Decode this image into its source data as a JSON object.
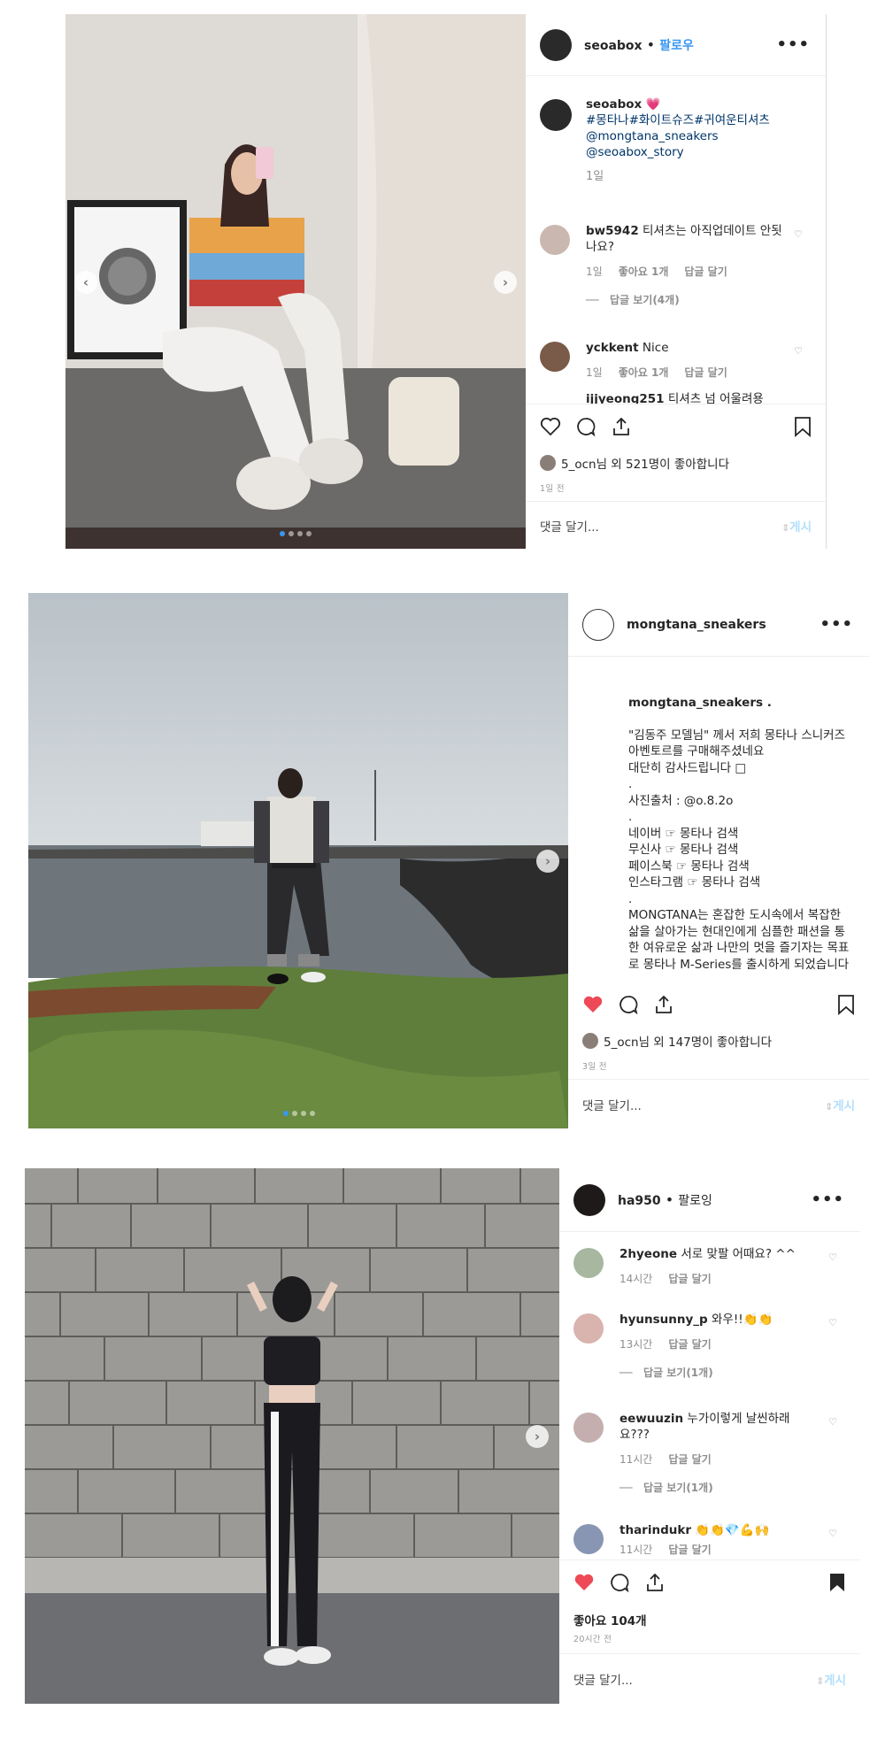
{
  "post1": {
    "username": "seoabox",
    "follow": "팔로우",
    "caption_user": "seoabox",
    "caption_text": "💗",
    "hashtags": "#몽타나#화이트슈즈#귀여운티셔츠",
    "mentions": [
      "@mongtana_sneakers",
      "@seoabox_story"
    ],
    "caption_time": "1일",
    "comments": [
      {
        "user": "bw5942",
        "text": "티셔츠는 아직업데이트 안됫나요?",
        "time": "1일",
        "likes": "좋아요 1개",
        "reply": "답글 달기",
        "view_replies": "답글 보기(4개)"
      },
      {
        "user": "yckkent",
        "text": "Nice",
        "time": "1일",
        "likes": "좋아요 1개",
        "reply": "답글 달기"
      },
      {
        "user": "ijjyeong251",
        "text": "티셔츠 넘 어울려용"
      }
    ],
    "likes_text": "5_ocn님 외 521명이 좋아합니다",
    "time": "1일 전",
    "add_comment": "댓글 달기...",
    "post_button": "게시"
  },
  "post2": {
    "username": "mongtana_sneakers",
    "caption_user": "mongtana_sneakers .",
    "caption_text": "\"김동주 모델님\" 께서 저희 몽타나 스니커즈 아벤토르를 구매해주셨네요\n대단히 감사드립니다 □\n.\n사진출처 : @o.8.2o\n.\n네이버 ☞ 몽타나 검색\n무신사 ☞ 몽타나 검색\n페이스북 ☞ 몽타나 검색\n인스타그램 ☞ 몽타나 검색\n.\nMONGTANA는 혼잡한 도시속에서 복잡한 삶을 살아가는 현대인에게 심플한 패션을 통한 여유로운 삶과 나만의 멋을 즐기자는 목표로 몽타나 M-Series를 출시하게 되었습니다\n.\n소바지들의 needs를 이해하고 오랜 신",
    "likes_text": "5_ocn님 외 147명이 좋아합니다",
    "time": "3일 전",
    "add_comment": "댓글 달기...",
    "post_button": "게시"
  },
  "post3": {
    "username": "ha950",
    "follow": "팔로잉",
    "comments": [
      {
        "user": "2hyeone",
        "text": "서로 맞팔 어때요? ^^",
        "time": "14시간",
        "reply": "답글 달기"
      },
      {
        "user": "hyunsunny_p",
        "text": "와우!!👏👏",
        "time": "13시간",
        "reply": "답글 달기",
        "view_replies": "답글 보기(1개)"
      },
      {
        "user": "eewuuzin",
        "text": "누가이렇게 날씬하래요???",
        "time": "11시간",
        "reply": "답글 달기",
        "view_replies": "답글 보기(1개)"
      },
      {
        "user": "tharindukr",
        "text": "👏👏💎💪🙌",
        "time": "11시간",
        "reply": "답글 달기"
      }
    ],
    "likes_text": "좋아요 104개",
    "time": "20시간 전",
    "add_comment": "댓글 달기...",
    "post_button": "게시"
  },
  "colors": {
    "heart_red": "#ed4956",
    "link_blue": "#3897f0",
    "post_btn": "#b2dffc"
  }
}
